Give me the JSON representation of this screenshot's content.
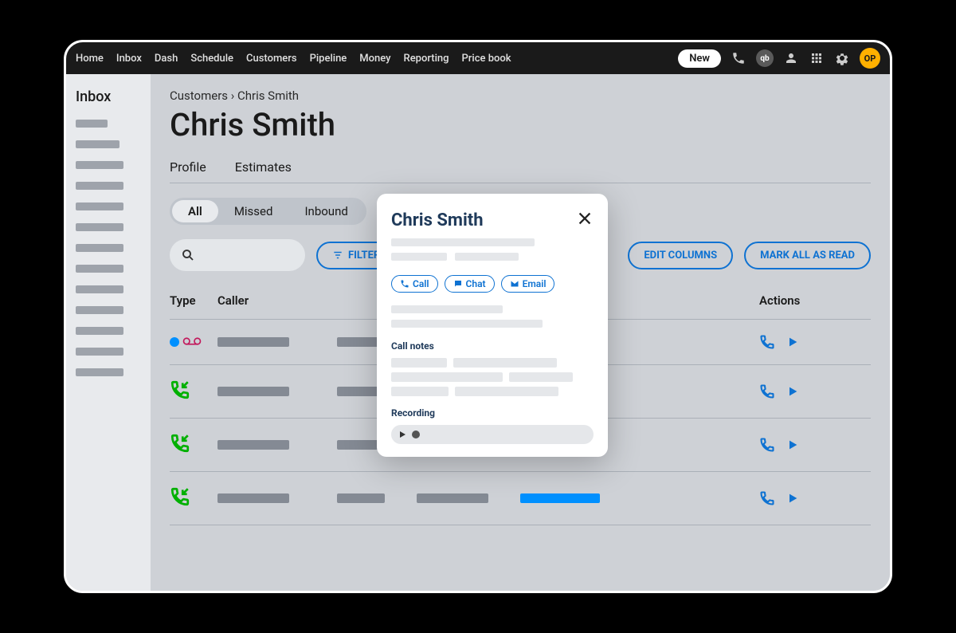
{
  "topnav": {
    "items": [
      "Home",
      "Inbox",
      "Dash",
      "Schedule",
      "Customers",
      "Pipeline",
      "Money",
      "Reporting",
      "Price book"
    ],
    "new_label": "New",
    "avatar_initials": "OP"
  },
  "sidebar": {
    "title": "Inbox"
  },
  "breadcrumb": "Customers › Chris Smith",
  "page_title": "Chris Smith",
  "tabs": [
    "Profile",
    "Estimates"
  ],
  "segmented": {
    "items": [
      "All",
      "Missed",
      "Inbound"
    ],
    "active": "All"
  },
  "toolbar": {
    "filter_label": "FILTER",
    "edit_columns_label": "EDIT COLUMNS",
    "mark_read_label": "MARK ALL AS READ"
  },
  "table": {
    "headers": {
      "type": "Type",
      "caller": "Caller",
      "actions": "Actions"
    },
    "rows": [
      {
        "type": "voicemail_unread"
      },
      {
        "type": "inbound"
      },
      {
        "type": "inbound"
      },
      {
        "type": "inbound"
      }
    ]
  },
  "modal": {
    "title": "Chris Smith",
    "call_btn": "Call",
    "chat_btn": "Chat",
    "email_btn": "Email",
    "call_notes_label": "Call notes",
    "recording_label": "Recording"
  },
  "colors": {
    "primary": "#0e72d2",
    "accent": "#ffb000",
    "green": "#00b000",
    "magenta": "#c2185b"
  }
}
